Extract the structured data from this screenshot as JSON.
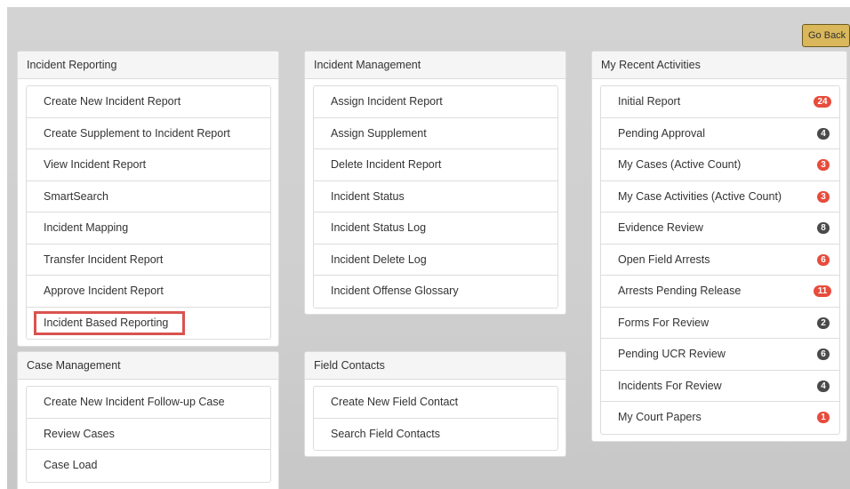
{
  "toolbar": {
    "go_back_label": "Go Back"
  },
  "incident_reporting": {
    "title": "Incident Reporting",
    "items": [
      "Create New Incident Report",
      "Create Supplement to Incident Report",
      "View Incident Report",
      "SmartSearch",
      "Incident Mapping",
      "Transfer Incident Report",
      "Approve Incident Report",
      "Incident Based Reporting"
    ]
  },
  "incident_management": {
    "title": "Incident Management",
    "items": [
      "Assign Incident Report",
      "Assign Supplement",
      "Delete Incident Report",
      "Incident Status",
      "Incident Status Log",
      "Incident Delete Log",
      "Incident Offense Glossary"
    ]
  },
  "case_management": {
    "title": "Case Management",
    "items": [
      "Create New Incident Follow-up Case",
      "Review Cases",
      "Case Load"
    ]
  },
  "field_contacts": {
    "title": "Field Contacts",
    "items": [
      "Create New Field Contact",
      "Search Field Contacts"
    ]
  },
  "recent_activities": {
    "title": "My Recent Activities",
    "items": [
      {
        "label": "Initial Report",
        "count": "24"
      },
      {
        "label": "Pending Approval",
        "count": "4"
      },
      {
        "label": "My Cases (Active Count)",
        "count": "3"
      },
      {
        "label": "My Case Activities (Active Count)",
        "count": "3"
      },
      {
        "label": "Evidence Review",
        "count": "8"
      },
      {
        "label": "Open Field Arrests",
        "count": "6"
      },
      {
        "label": "Arrests Pending Release",
        "count": "11"
      },
      {
        "label": "Forms For Review",
        "count": "2"
      },
      {
        "label": "Pending UCR Review",
        "count": "6"
      },
      {
        "label": "Incidents For Review",
        "count": "4"
      },
      {
        "label": "My Court Papers",
        "count": "1"
      }
    ]
  },
  "colors": {
    "badge_red": "#e74c3c",
    "badge_dark": "#4a4a4a",
    "highlight": "#d9534f",
    "go_back": "#d9b75a"
  }
}
